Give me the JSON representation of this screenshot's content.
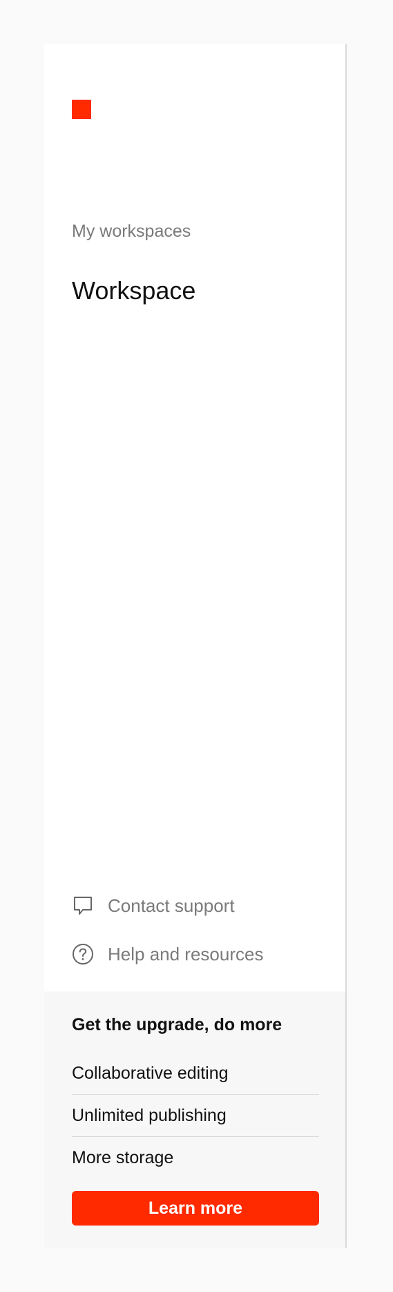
{
  "brand": {
    "logo_color": "#ff2a00"
  },
  "workspaces": {
    "section_label": "My workspaces",
    "items": [
      {
        "label": "Workspace"
      }
    ]
  },
  "footer_links": {
    "support": {
      "label": "Contact support",
      "icon": "chat-bubble-icon"
    },
    "help": {
      "label": "Help and resources",
      "icon": "question-circle-icon"
    }
  },
  "upgrade": {
    "title": "Get the upgrade, do more",
    "features": [
      {
        "label": "Collaborative editing"
      },
      {
        "label": "Unlimited publishing"
      },
      {
        "label": "More storage"
      }
    ],
    "cta_label": "Learn more",
    "cta_color": "#ff2a00"
  }
}
